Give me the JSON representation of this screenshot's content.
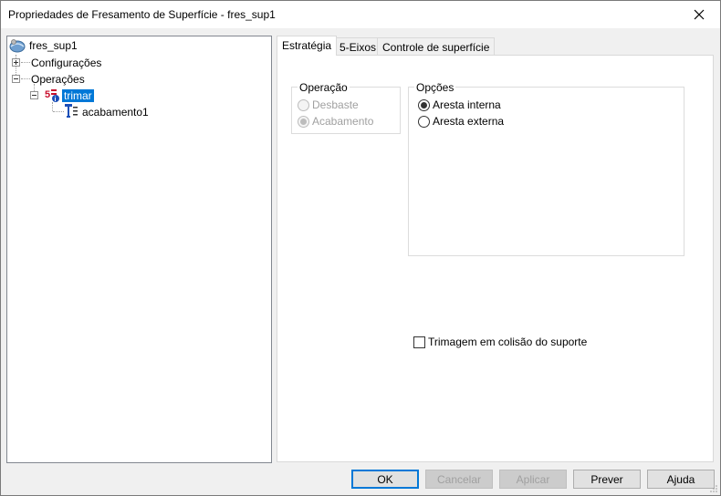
{
  "window": {
    "title": "Propriedades de Fresamento de Superfície - fres_sup1"
  },
  "tree": {
    "root": {
      "label": "fres_sup1",
      "icon": "surface-mill-icon"
    },
    "items": [
      {
        "label": "Configurações",
        "expander": "plus"
      },
      {
        "label": "Operações",
        "expander": "minus"
      },
      {
        "label": "trimar",
        "expander": "minus",
        "icon": "trim-operation-icon",
        "selected": true
      },
      {
        "label": "acabamento1",
        "icon": "finishing-tool-icon"
      }
    ]
  },
  "tabs": [
    {
      "label": "Estratégia",
      "active": true
    },
    {
      "label": "5-Eixos",
      "active": false
    },
    {
      "label": "Controle de superfície",
      "active": false
    }
  ],
  "strategy": {
    "operation_group": {
      "title": "Operação",
      "options": [
        {
          "label": "Desbaste",
          "checked": false,
          "disabled": true
        },
        {
          "label": "Acabamento",
          "checked": true,
          "disabled": true
        }
      ]
    },
    "options_group": {
      "title": "Opções",
      "options": [
        {
          "label": "Aresta interna",
          "checked": true
        },
        {
          "label": "Aresta externa",
          "checked": false
        }
      ]
    },
    "trim_collision_checkbox": {
      "label": "Trimagem em colisão do suporte",
      "checked": false
    }
  },
  "buttons": {
    "ok": "OK",
    "cancel": "Cancelar",
    "apply": "Aplicar",
    "preview": "Prever",
    "help": "Ajuda"
  },
  "colors": {
    "selection": "#0078d7",
    "default_button_border": "#0078d7"
  }
}
